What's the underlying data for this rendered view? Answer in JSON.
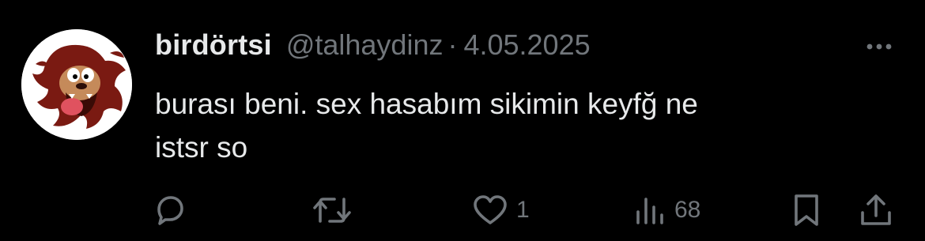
{
  "tweet": {
    "display_name": "birdörtsi",
    "handle": "@talhaydinz",
    "separator": "·",
    "date": "4.05.2025",
    "text_line_1": "burası beni. sex hasabım sikimin keyfğ ne",
    "text_line_2": "istsr so"
  },
  "actions": {
    "reply_icon": "reply-bubble-icon",
    "retweet_icon": "retweet-arrows-icon",
    "like_icon": "heart-icon",
    "like_count": "1",
    "views_icon": "bar-chart-icon",
    "views_count": "68",
    "bookmark_icon": "bookmark-icon",
    "share_icon": "share-upload-icon"
  },
  "colors": {
    "background": "#000000",
    "text_primary": "#e7e9ea",
    "text_secondary": "#71767b"
  }
}
